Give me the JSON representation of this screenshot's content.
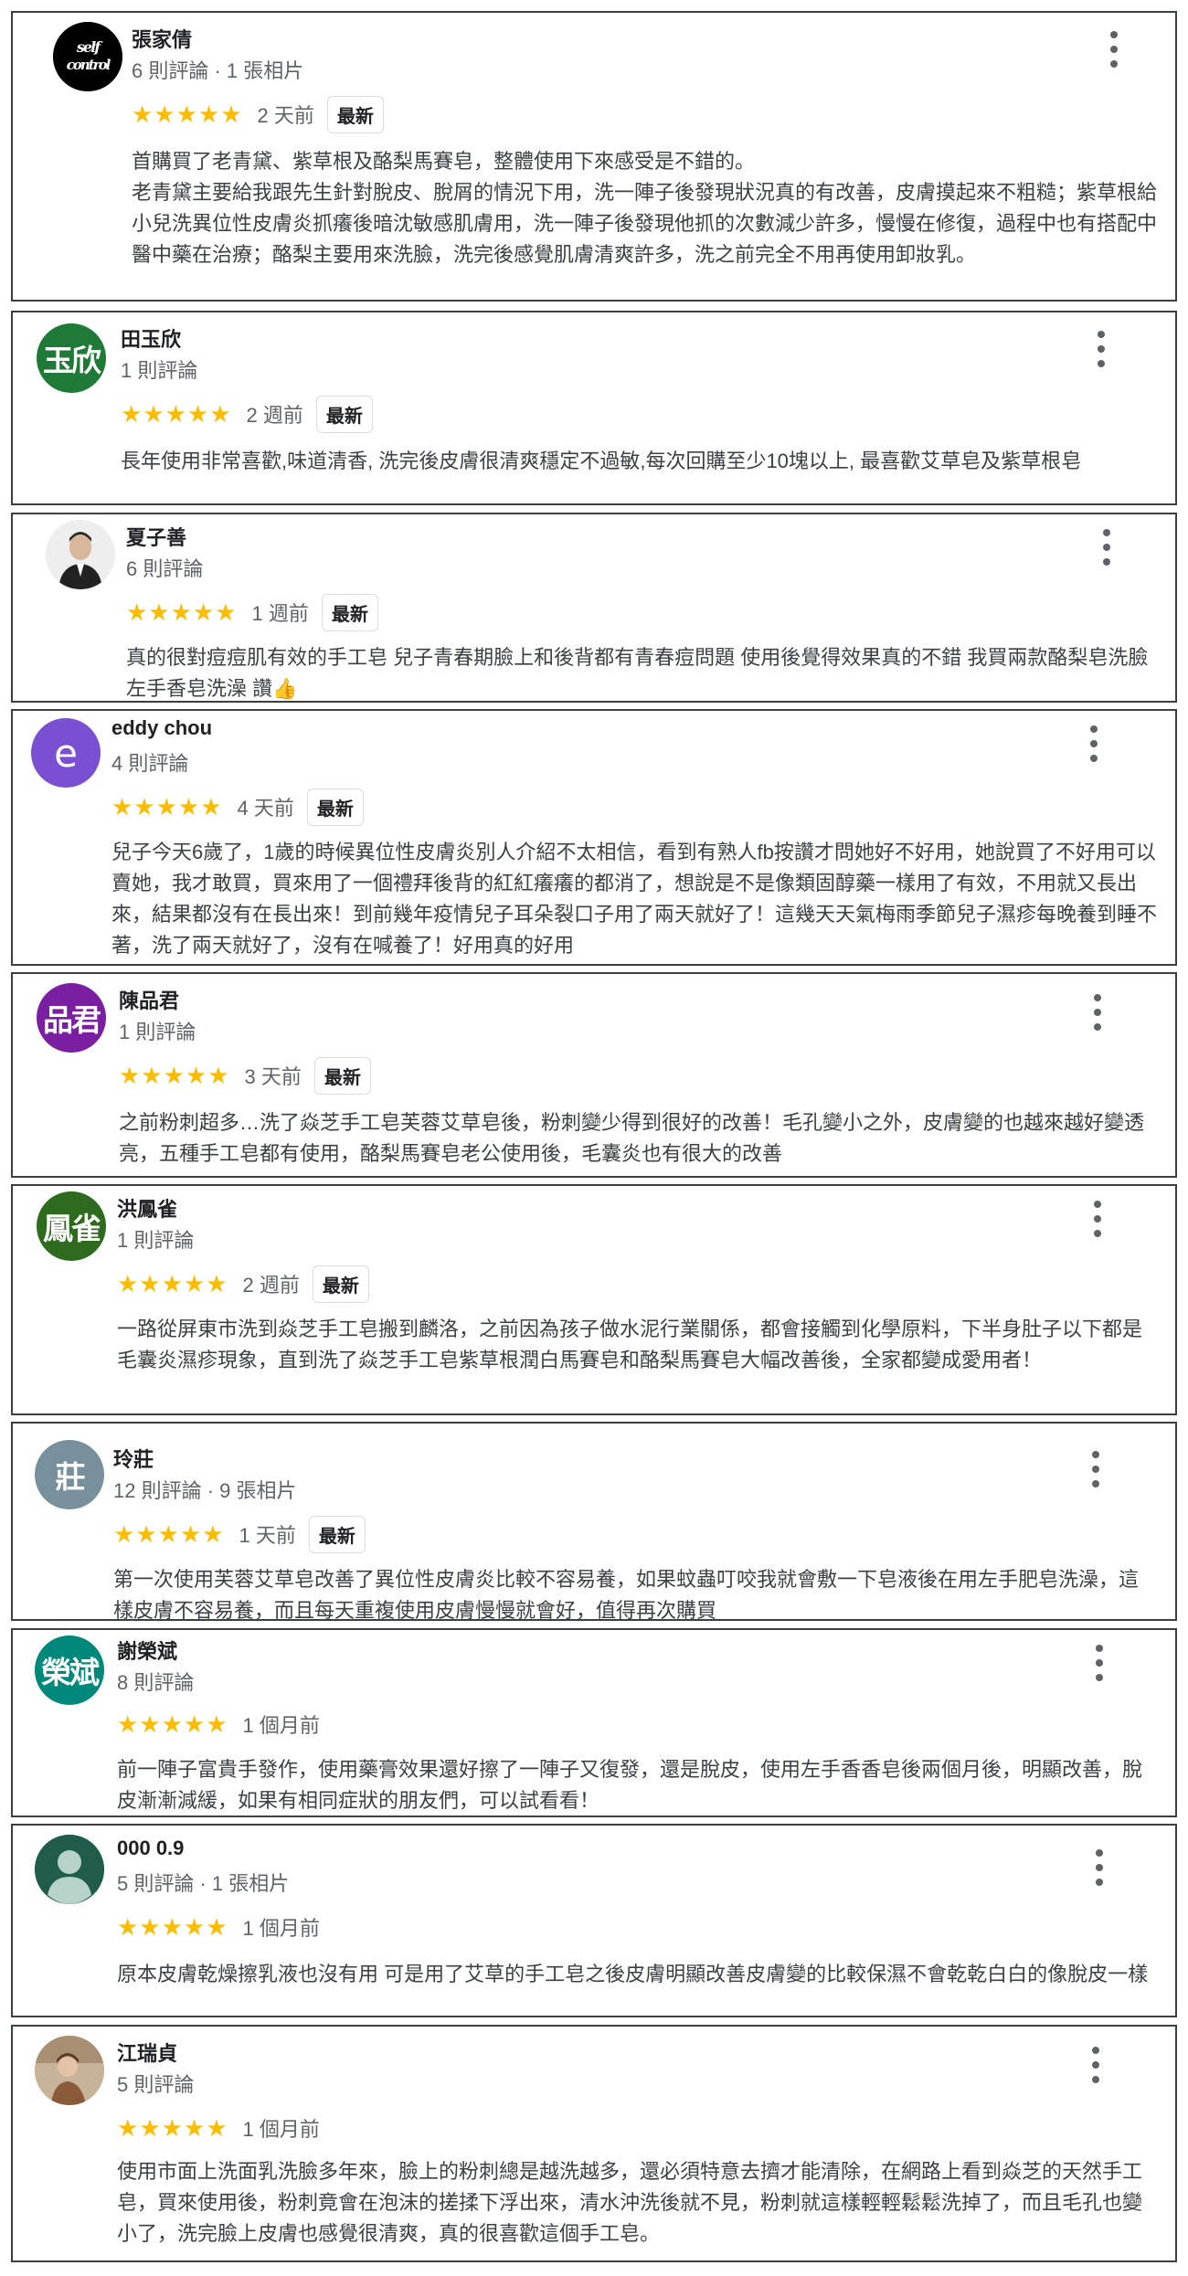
{
  "reviews": [
    {
      "name": "張家倩",
      "meta": "6 則評論 · 1 張相片",
      "stars": "★★★★★",
      "time": "2 天前",
      "badge": "最新",
      "avatar": {
        "type": "logo",
        "text": "self control",
        "bg": "#000000"
      },
      "paragraphs": [
        "首購買了老青黛、紫草根及酪梨馬賽皂，整體使用下來感受是不錯的。",
        "老青黛主要給我跟先生針對脫皮、脫屑的情況下用，洗一陣子後發現狀況真的有改善，皮膚摸起來不粗糙；紫草根給小兒洗異位性皮膚炎抓癢後暗沈敏感肌膚用，洗一陣子後發現他抓的次數減少許多，慢慢在修復，過程中也有搭配中醫中藥在治療；酪梨主要用來洗臉，洗完後感覺肌膚清爽許多，洗之前完全不用再使用卸妝乳。"
      ]
    },
    {
      "name": "田玉欣",
      "meta": "1 則評論",
      "stars": "★★★★★",
      "time": "2 週前",
      "badge": "最新",
      "avatar": {
        "type": "text",
        "text": "玉欣",
        "bg": "#1e7a36"
      },
      "paragraphs": [
        "長年使用非常喜歡,味道清香, 洗完後皮膚很清爽穩定不過敏,每次回購至少10塊以上, 最喜歡艾草皂及紫草根皂"
      ]
    },
    {
      "name": "夏子善",
      "meta": "6 則評論",
      "stars": "★★★★★",
      "time": "1 週前",
      "badge": "最新",
      "avatar": {
        "type": "photo",
        "text": "",
        "bg": "#e8e8e8"
      },
      "paragraphs": [
        "真的很對痘痘肌有效的手工皂 兒子青春期臉上和後背都有青春痘問題 使用後覺得效果真的不錯 我買兩款酪梨皂洗臉 左手香皂洗澡 讚👍"
      ]
    },
    {
      "name": "eddy chou",
      "meta": "4 則評論",
      "stars": "★★★★★",
      "time": "4 天前",
      "badge": "最新",
      "avatar": {
        "type": "letter",
        "text": "e",
        "bg": "#7b4fd1"
      },
      "paragraphs": [
        "兒子今天6歲了，1歲的時候異位性皮膚炎別人介紹不太相信，看到有熟人fb按讚才問她好不好用，她說買了不好用可以賣她，我才敢買，買來用了一個禮拜後背的紅紅癢癢的都消了，想說是不是像類固醇藥一樣用了有效，不用就又長出來，結果都沒有在長出來！到前幾年疫情兒子耳朵裂口子用了兩天就好了！這幾天天氣梅雨季節兒子濕疹每晚養到睡不著，洗了兩天就好了，沒有在喊養了！好用真的好用"
      ]
    },
    {
      "name": "陳品君",
      "meta": "1 則評論",
      "stars": "★★★★★",
      "time": "3 天前",
      "badge": "最新",
      "avatar": {
        "type": "text",
        "text": "品君",
        "bg": "#7b1fa2"
      },
      "paragraphs": [
        "之前粉刺超多…洗了焱芝手工皂芙蓉艾草皂後，粉刺變少得到很好的改善！毛孔變小之外，皮膚變的也越來越好變透亮，五種手工皂都有使用，酪梨馬賽皂老公使用後，毛囊炎也有很大的改善"
      ]
    },
    {
      "name": "洪鳳雀",
      "meta": "1 則評論",
      "stars": "★★★★★",
      "time": "2 週前",
      "badge": "最新",
      "avatar": {
        "type": "text",
        "text": "鳳雀",
        "bg": "#2e6b1e"
      },
      "paragraphs": [
        "一路從屏東市洗到焱芝手工皂搬到麟洛，之前因為孩子做水泥行業關係，都會接觸到化學原料，下半身肚子以下都是毛囊炎濕疹現象，直到洗了焱芝手工皂紫草根潤白馬賽皂和酪梨馬賽皂大幅改善後，全家都變成愛用者！"
      ]
    },
    {
      "name": "玲莊",
      "meta": "12 則評論 · 9 張相片",
      "stars": "★★★★★",
      "time": "1 天前",
      "badge": "最新",
      "avatar": {
        "type": "text",
        "text": "莊",
        "bg": "#78909c"
      },
      "paragraphs": [
        "第一次使用芙蓉艾草皂改善了異位性皮膚炎比較不容易養，如果蚊蟲叮咬我就會敷一下皂液後在用左手肥皂洗澡，這樣皮膚不容易養，而且每天重複使用皮膚慢慢就會好，值得再次購買"
      ]
    },
    {
      "name": "謝榮斌",
      "meta": "8 則評論",
      "stars": "★★★★★",
      "time": "1 個月前",
      "badge": "",
      "avatar": {
        "type": "text",
        "text": "榮斌",
        "bg": "#00897b"
      },
      "paragraphs": [
        "前一陣子富貴手發作，使用藥膏效果還好擦了一陣子又復發，還是脫皮，使用左手香香皂後兩個月後，明顯改善，脫皮漸漸減緩，如果有相同症狀的朋友們，可以試看看！"
      ]
    },
    {
      "name": "000 0.9",
      "meta": "5 則評論 · 1 張相片",
      "stars": "★★★★★",
      "time": "1 個月前",
      "badge": "",
      "avatar": {
        "type": "person",
        "text": "",
        "bg": "#1f5c4a"
      },
      "paragraphs": [
        "原本皮膚乾燥擦乳液也沒有用 可是用了艾草的手工皂之後皮膚明顯改善皮膚變的比較保濕不會乾乾白白的像脫皮一樣"
      ]
    },
    {
      "name": "江瑞貞",
      "meta": "5 則評論",
      "stars": "★★★★★",
      "time": "1 個月前",
      "badge": "",
      "avatar": {
        "type": "photo2",
        "text": "",
        "bg": "#c9a27a"
      },
      "paragraphs": [
        "使用市面上洗面乳洗臉多年來，臉上的粉刺總是越洗越多，還必須特意去擠才能清除，在網路上看到焱芝的天然手工皂，買來使用後，粉刺竟會在泡沫的搓揉下浮出來，清水沖洗後就不見，粉刺就這樣輕輕鬆鬆洗掉了，而且毛孔也變小了，洗完臉上皮膚也感覺很清爽，真的很喜歡這個手工皂。"
      ]
    }
  ]
}
